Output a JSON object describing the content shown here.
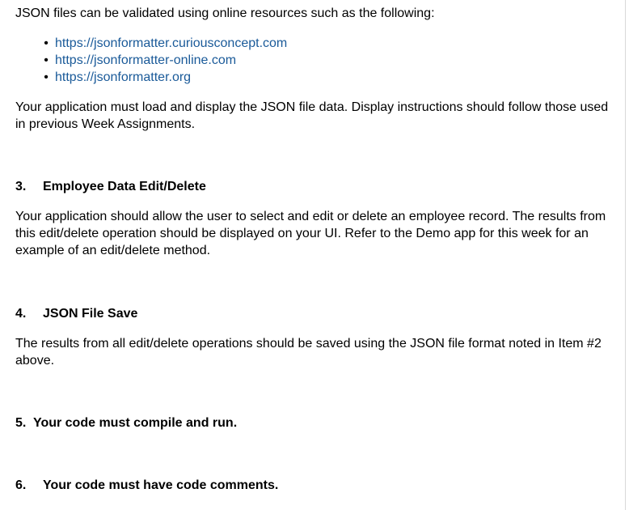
{
  "intro": "JSON files can be validated using online resources such as the following:",
  "links": [
    "https://jsonformatter.curiousconcept.com",
    "https://jsonformatter-online.com",
    "https://jsonformatter.org"
  ],
  "bullet_char": "•",
  "para_display": "Your application must load and display the JSON file data.  Display instructions should follow those used in previous Week Assignments.",
  "section3": {
    "number": "3.",
    "title": "Employee Data Edit/Delete",
    "body": "Your application should allow the user to select and edit or delete an employee record.  The results from this edit/delete operation should be displayed on your UI.  Refer to the Demo app for this week for an example of an edit/delete method."
  },
  "section4": {
    "number": "4.",
    "title": "JSON File Save",
    "body": "The results from all edit/delete operations should be saved using the JSON file format noted in Item #2 above."
  },
  "section5": {
    "number": "5.",
    "title": "Your code must compile and run."
  },
  "section6": {
    "number": "6.",
    "title": "Your code must have code comments."
  },
  "colors": {
    "link": "#1a5a99",
    "text": "#000000"
  }
}
